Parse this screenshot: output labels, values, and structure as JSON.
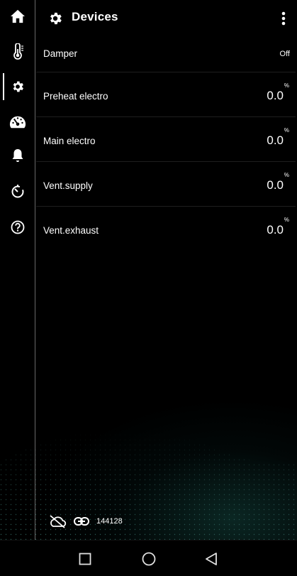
{
  "header": {
    "title": "Devices",
    "gear_icon": "gear-icon",
    "menu_icon": "more-vert-icon"
  },
  "sidebar": {
    "items": [
      {
        "name": "home",
        "icon": "home-icon"
      },
      {
        "name": "temperature",
        "icon": "thermometer-icon"
      },
      {
        "name": "devices",
        "icon": "gear-icon",
        "active": true
      },
      {
        "name": "dashboard",
        "icon": "speedometer-icon"
      },
      {
        "name": "alarms",
        "icon": "bell-icon"
      },
      {
        "name": "timer",
        "icon": "timer-icon"
      },
      {
        "name": "help",
        "icon": "help-icon"
      }
    ]
  },
  "rows": [
    {
      "label": "Damper",
      "value": "Off"
    },
    {
      "label": "Preheat electro",
      "value": "0.0",
      "unit": "%"
    },
    {
      "label": "Main electro",
      "value": "0.0",
      "unit": "%"
    },
    {
      "label": "Vent.supply",
      "value": "0.0",
      "unit": "%"
    },
    {
      "label": "Vent.exhaust",
      "value": "0.0",
      "unit": "%"
    }
  ],
  "status": {
    "cloud_icon": "cloud-off-icon",
    "link_icon": "link-icon",
    "device_id": "144128"
  },
  "navbar": {
    "recents_icon": "square-icon",
    "home_icon": "circle-icon",
    "back_icon": "triangle-back-icon"
  },
  "colors": {
    "background": "#000000",
    "text": "#ffffff",
    "divider": "#1e1e1e",
    "sidebar_border": "#6a6a6a"
  }
}
